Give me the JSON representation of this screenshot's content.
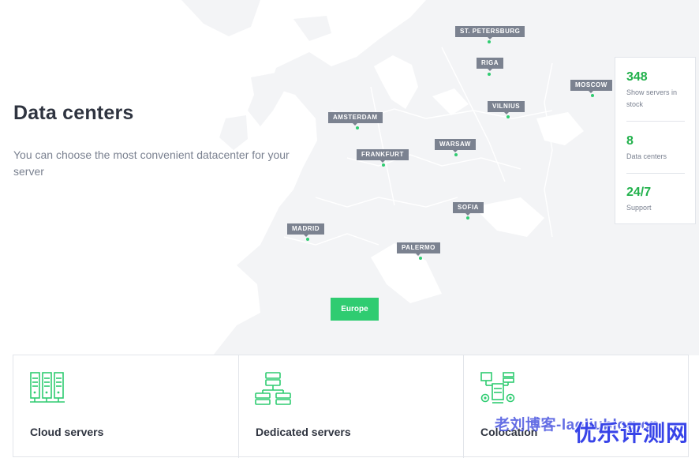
{
  "hero": {
    "title": "Data centers",
    "subtitle": "You can choose the most convenient datacenter for your server"
  },
  "cities": [
    {
      "id": "st-petersburg",
      "label": "ST. PETERSBURG"
    },
    {
      "id": "riga",
      "label": "RIGA"
    },
    {
      "id": "moscow",
      "label": "MOSCOW"
    },
    {
      "id": "vilnius",
      "label": "VILNIUS"
    },
    {
      "id": "amsterdam",
      "label": "AMSTERDAM"
    },
    {
      "id": "frankfurt",
      "label": "FRANKFURT"
    },
    {
      "id": "warsaw",
      "label": "WARSAW"
    },
    {
      "id": "sofia",
      "label": "SOFIA"
    },
    {
      "id": "madrid",
      "label": "MADRID"
    },
    {
      "id": "palermo",
      "label": "PALERMO"
    }
  ],
  "region_button": "Europe",
  "stats": [
    {
      "value": "348",
      "label": "Show servers in stock"
    },
    {
      "value": "8",
      "label": "Data centers"
    },
    {
      "value": "24/7",
      "label": "Support"
    }
  ],
  "cards": [
    {
      "title": "Cloud servers",
      "icon": "server-rack-icon"
    },
    {
      "title": "Dedicated servers",
      "icon": "server-network-icon"
    },
    {
      "title": "Colocation",
      "icon": "colocation-gears-icon"
    }
  ],
  "colors": {
    "accent": "#2fcc71",
    "stat_value": "#22b14c",
    "label_bg": "#7b8290",
    "map": "#f3f4f6"
  },
  "watermark": {
    "blog": "老刘博客-laoliublog.cn",
    "brand": "优乐评测网"
  }
}
